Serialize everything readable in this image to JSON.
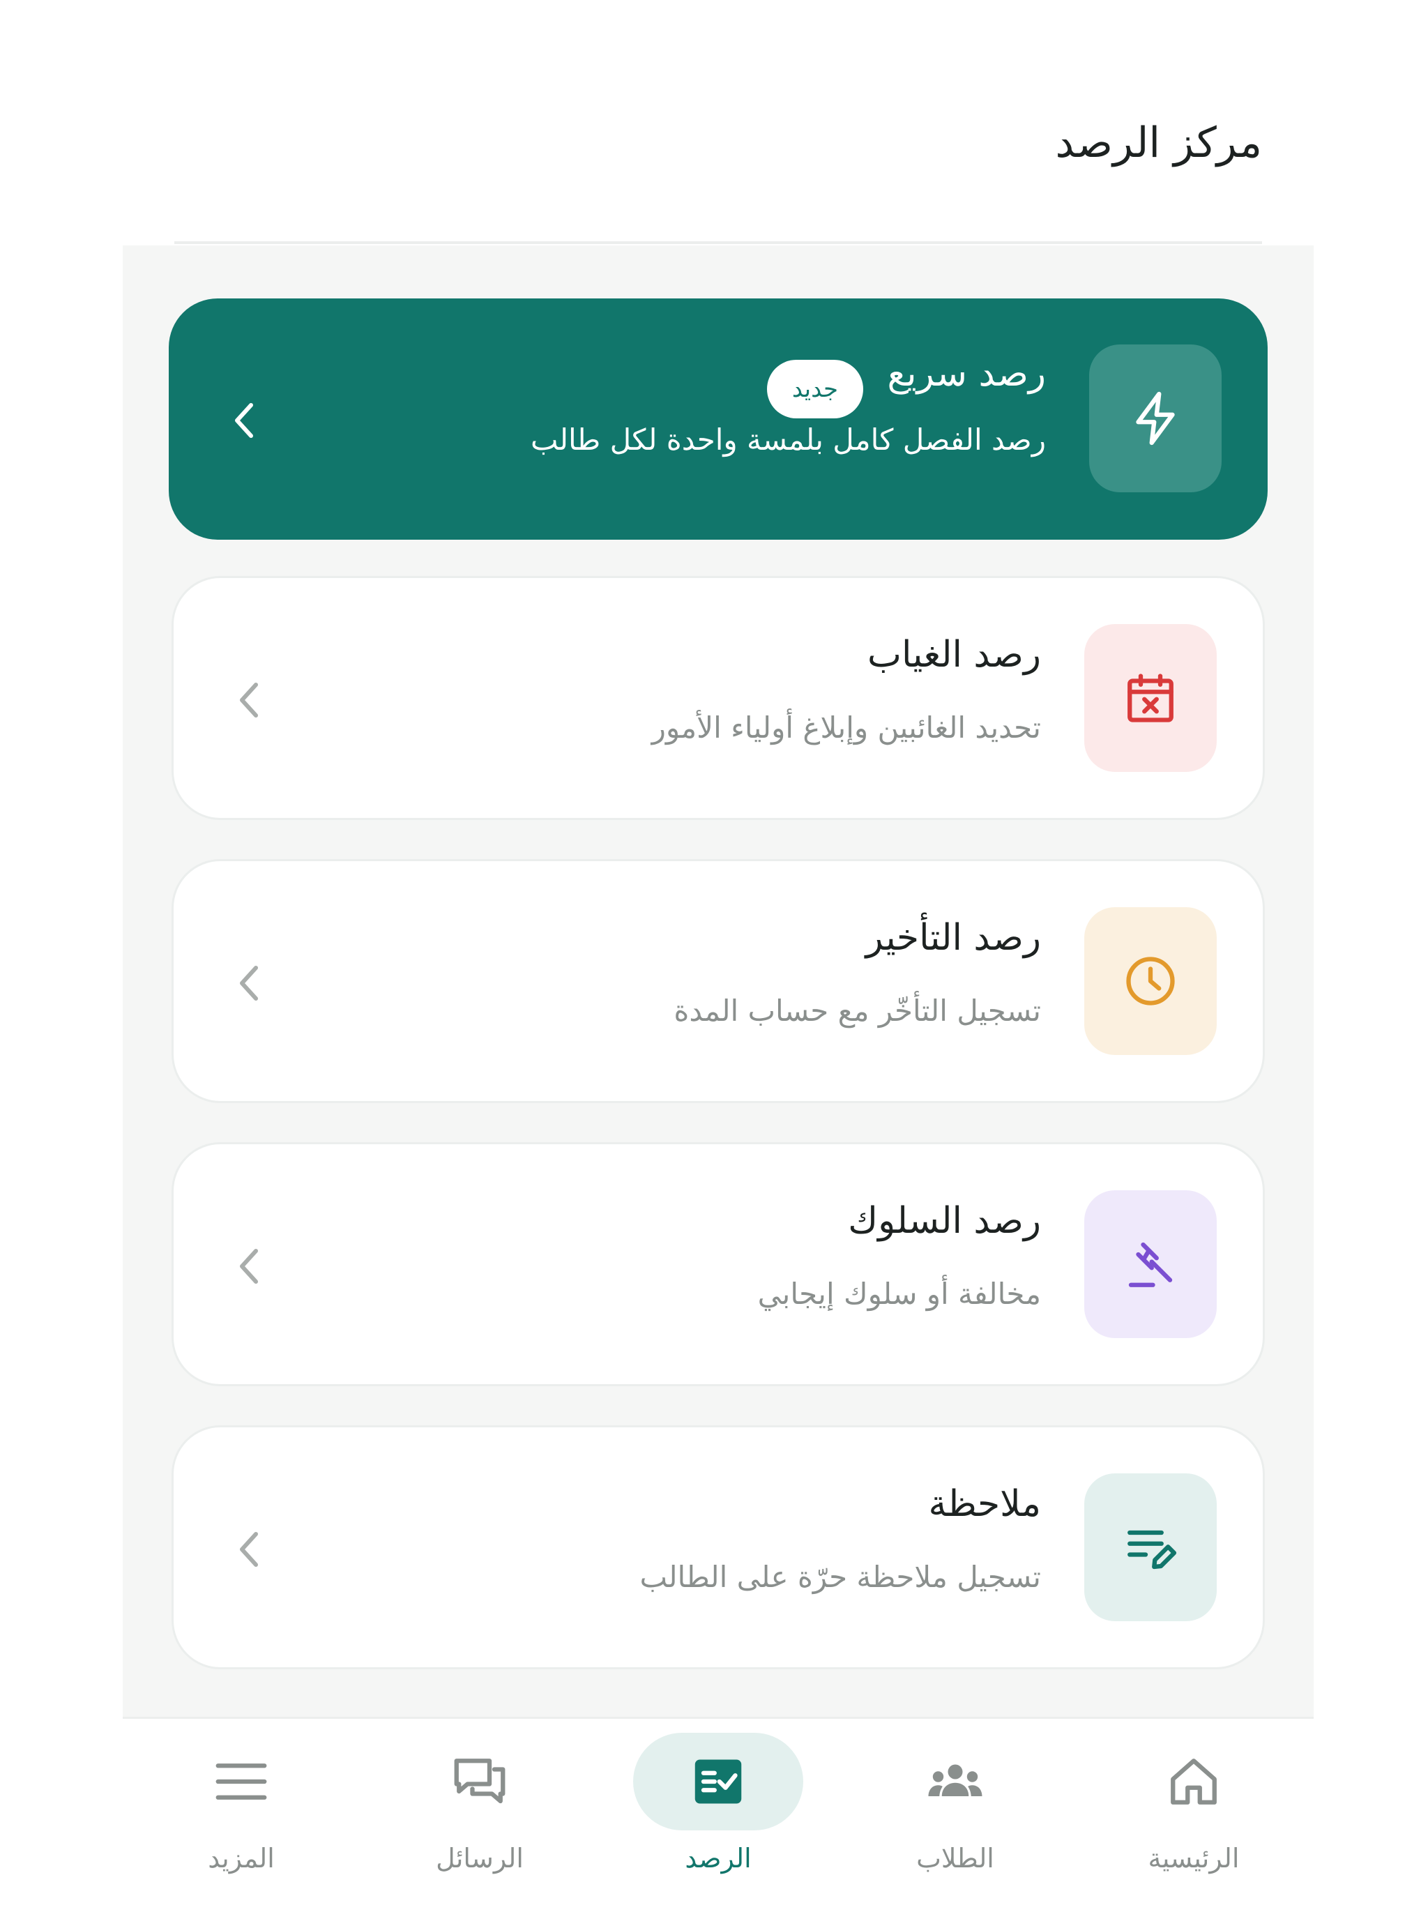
{
  "header": {
    "title": "مركز الرصد"
  },
  "cards": [
    {
      "id": "quick",
      "title": "رصد سريع",
      "badge": "جديد",
      "subtitle": "رصد الفصل كامل بلمسة واحدة لكل طالب",
      "icon": "lightning-icon",
      "icon_bg": "#3a9187",
      "icon_color": "#ffffff"
    },
    {
      "id": "absence",
      "title": "رصد الغياب",
      "subtitle": "تحديد الغائبين وإبلاغ أولياء الأمور",
      "icon": "calendar-x-icon",
      "icon_bg": "#fce9e9",
      "icon_color": "#d93a3a"
    },
    {
      "id": "late",
      "title": "رصد التأخير",
      "subtitle": "تسجيل التأخّر مع حساب المدة",
      "icon": "clock-icon",
      "icon_bg": "#fbf0df",
      "icon_color": "#e39a2c"
    },
    {
      "id": "behavior",
      "title": "رصد السلوك",
      "subtitle": "مخالفة أو سلوك إيجابي",
      "icon": "gavel-icon",
      "icon_bg": "#efe9fb",
      "icon_color": "#7b4fd1"
    },
    {
      "id": "note",
      "title": "ملاحظة",
      "subtitle": "تسجيل ملاحظة حرّة على الطالب",
      "icon": "note-pen-icon",
      "icon_bg": "#e3f0ee",
      "icon_color": "#11766b"
    }
  ],
  "nav": [
    {
      "label": "الرئيسية",
      "icon": "home-icon",
      "active": false
    },
    {
      "label": "الطلاب",
      "icon": "students-icon",
      "active": false
    },
    {
      "label": "الرصد",
      "icon": "checklist-icon",
      "active": true
    },
    {
      "label": "الرسائل",
      "icon": "chat-icon",
      "active": false
    },
    {
      "label": "المزيد",
      "icon": "menu-icon",
      "active": false
    }
  ],
  "colors": {
    "primary": "#11766b",
    "background": "#f5f6f5",
    "text": "#1d2221",
    "muted": "#8a8f8d"
  }
}
